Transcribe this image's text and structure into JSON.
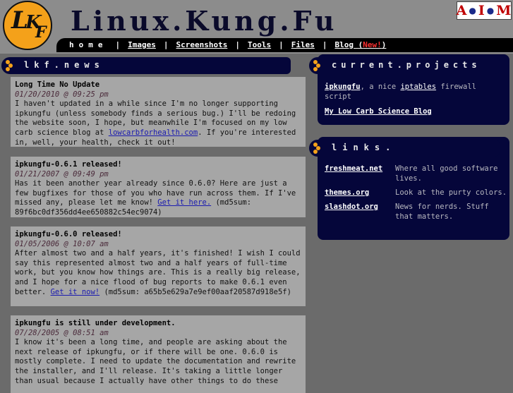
{
  "header": {
    "logo_text": "LKF",
    "title": "Linux.Kung.Fu",
    "aim_badge": {
      "a": "A",
      "i": "I",
      "m": "M"
    }
  },
  "nav": {
    "home": "home",
    "images": "Images",
    "screenshots": "Screenshots",
    "tools": "Tools",
    "files": "Files",
    "blog": "Blog (",
    "blog_new": "New!",
    "blog_close": ")",
    "separator": "|"
  },
  "news": {
    "heading": "lkf.news",
    "posts": [
      {
        "title": "Long Time No Update",
        "date": "01/20/2010 @ 09:25 pm",
        "body_before": "I haven't updated in a while since I'm no longer supporting ipkungfu (unless somebody finds a serious bug.) I'll be redoing the website soon, I hope, but meanwhile I'm focused on my low carb science blog at ",
        "link": "lowcarbforhealth.com",
        "body_after": ". If you're interested in, well, your health, check it out!"
      },
      {
        "title": "ipkungfu-0.6.1 released!",
        "date": "01/21/2007 @ 09:49 pm",
        "body_before": "Has it been another year already since 0.6.0? Here are just a few bugfixes for those of you who have run across them. If I've missed any, please let me know! ",
        "link": "Get it here.",
        "body_after": " (md5sum: 89f6bc0df356dd4ee650882c54ec9074)"
      },
      {
        "title": "ipkungfu-0.6.0 released!",
        "date": "01/05/2006 @ 10:07 am",
        "body_before": "After almost two and a half years, it's finished! I wish I could say this represented almost two and a half years of full-time work, but you know how things are. This is a really big release, and I hope for a nice flood of bug reports to make 0.6.1 even better. ",
        "link": "Get it now!",
        "body_after": " (md5sum: a65b5e629a7e9ef00aaf20587d918e5f)"
      },
      {
        "title": "ipkungfu is still under development.",
        "date": "07/28/2005 @ 08:51 am",
        "body_before": "I know it's been a long time, and people are asking about the next release of ipkungfu, or if there will be one. 0.6.0 is mostly complete. I need to update the documentation and rewrite the installer, and I'll release. It's taking a little longer than usual because I actually have other things to do these",
        "link": "",
        "body_after": ""
      }
    ]
  },
  "projects": {
    "heading": "current.projects",
    "item1_link": "ipkungfu",
    "item1_mid": ", a nice ",
    "item1_link2": "iptables",
    "item1_after": " firewall script",
    "item2_link": "My Low Carb Science Blog"
  },
  "links": {
    "heading": "links.",
    "rows": [
      {
        "name": "freshmeat.net",
        "desc": "Where all good software lives."
      },
      {
        "name": "themes.org",
        "desc": "Look at the purty colors."
      },
      {
        "name": "slashdot.org",
        "desc": "News for nerds. Stuff that matters."
      }
    ]
  },
  "colors": {
    "background": "#6b6b6b",
    "header": "#8c8c8c",
    "panel": "#05063a",
    "accent": "#f4a11a",
    "post_bg": "#a6a6a6",
    "link": "#1a1ab0"
  }
}
